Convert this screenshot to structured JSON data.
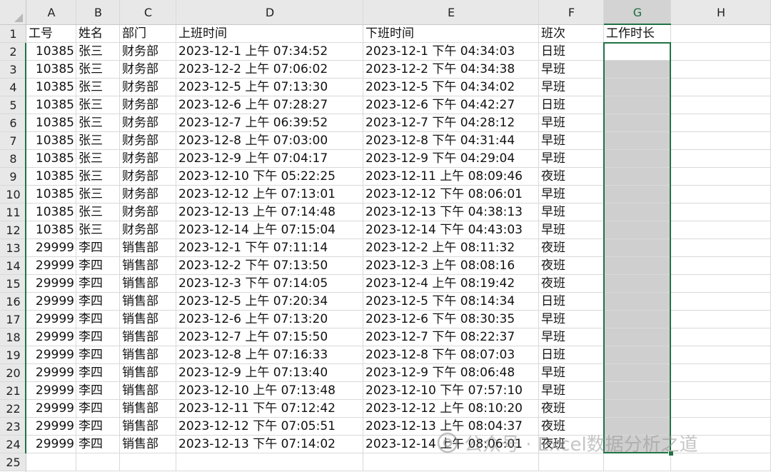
{
  "columns": [
    "A",
    "B",
    "C",
    "D",
    "E",
    "F",
    "G",
    "H"
  ],
  "selected_column": "G",
  "header_row": [
    "工号",
    "姓名",
    "部门",
    "上班时间",
    "下班时间",
    "班次",
    "工作时长"
  ],
  "rows": [
    [
      "10385",
      "张三",
      "财务部",
      "2023-12-1 上午 07:34:52",
      "2023-12-1 下午 04:34:03",
      "日班"
    ],
    [
      "10385",
      "张三",
      "财务部",
      "2023-12-2 上午 07:06:02",
      "2023-12-2 下午 04:34:38",
      "早班"
    ],
    [
      "10385",
      "张三",
      "财务部",
      "2023-12-5 上午 07:13:30",
      "2023-12-5 下午 04:34:02",
      "早班"
    ],
    [
      "10385",
      "张三",
      "财务部",
      "2023-12-6 上午 07:28:27",
      "2023-12-6 下午 04:42:27",
      "日班"
    ],
    [
      "10385",
      "张三",
      "财务部",
      "2023-12-7 上午 06:39:52",
      "2023-12-7 下午 04:28:12",
      "早班"
    ],
    [
      "10385",
      "张三",
      "财务部",
      "2023-12-8 上午 07:03:00",
      "2023-12-8 下午 04:31:44",
      "早班"
    ],
    [
      "10385",
      "张三",
      "财务部",
      "2023-12-9 上午 07:04:17",
      "2023-12-9 下午 04:29:04",
      "早班"
    ],
    [
      "10385",
      "张三",
      "财务部",
      "2023-12-10 下午 05:22:25",
      "2023-12-11 上午 08:09:46",
      "夜班"
    ],
    [
      "10385",
      "张三",
      "财务部",
      "2023-12-12 上午 07:13:01",
      "2023-12-12 下午 08:06:01",
      "早班"
    ],
    [
      "10385",
      "张三",
      "财务部",
      "2023-12-13 上午 07:14:48",
      "2023-12-13 下午 04:38:13",
      "早班"
    ],
    [
      "10385",
      "张三",
      "财务部",
      "2023-12-14 上午 07:15:04",
      "2023-12-14 下午 04:43:03",
      "早班"
    ],
    [
      "29999",
      "李四",
      "销售部",
      "2023-12-1 下午 07:11:14",
      "2023-12-2 上午 08:11:32",
      "夜班"
    ],
    [
      "29999",
      "李四",
      "销售部",
      "2023-12-2 下午 07:13:50",
      "2023-12-3 上午 08:08:16",
      "夜班"
    ],
    [
      "29999",
      "李四",
      "销售部",
      "2023-12-3 下午 07:14:05",
      "2023-12-4 上午 08:19:42",
      "夜班"
    ],
    [
      "29999",
      "李四",
      "销售部",
      "2023-12-5 上午 07:20:34",
      "2023-12-5 下午 08:14:34",
      "日班"
    ],
    [
      "29999",
      "李四",
      "销售部",
      "2023-12-6 上午 07:13:20",
      "2023-12-6 下午 08:30:35",
      "早班"
    ],
    [
      "29999",
      "李四",
      "销售部",
      "2023-12-7 上午 07:15:50",
      "2023-12-7 下午 08:22:37",
      "早班"
    ],
    [
      "29999",
      "李四",
      "销售部",
      "2023-12-8 上午 07:16:33",
      "2023-12-8 下午 08:07:03",
      "日班"
    ],
    [
      "29999",
      "李四",
      "销售部",
      "2023-12-9 上午 07:13:40",
      "2023-12-9 下午 08:06:48",
      "早班"
    ],
    [
      "29999",
      "李四",
      "销售部",
      "2023-12-10 上午 07:13:48",
      "2023-12-10 下午 07:57:10",
      "早班"
    ],
    [
      "29999",
      "李四",
      "销售部",
      "2023-12-11 下午 07:12:42",
      "2023-12-12 上午 08:10:20",
      "夜班"
    ],
    [
      "29999",
      "李四",
      "销售部",
      "2023-12-12 下午 07:05:51",
      "2023-12-13 上午 08:04:37",
      "夜班"
    ],
    [
      "29999",
      "李四",
      "销售部",
      "2023-12-13 下午 07:14:02",
      "2023-12-14 上午 08:06:01",
      "夜班"
    ]
  ],
  "watermark": {
    "text": "公众号 · Excel数据分析之道"
  },
  "colors": {
    "selection": "#217346",
    "header_bg": "#e8e8e8",
    "selected_fill": "#cfcfcf",
    "gridline": "#d9d9d9"
  }
}
